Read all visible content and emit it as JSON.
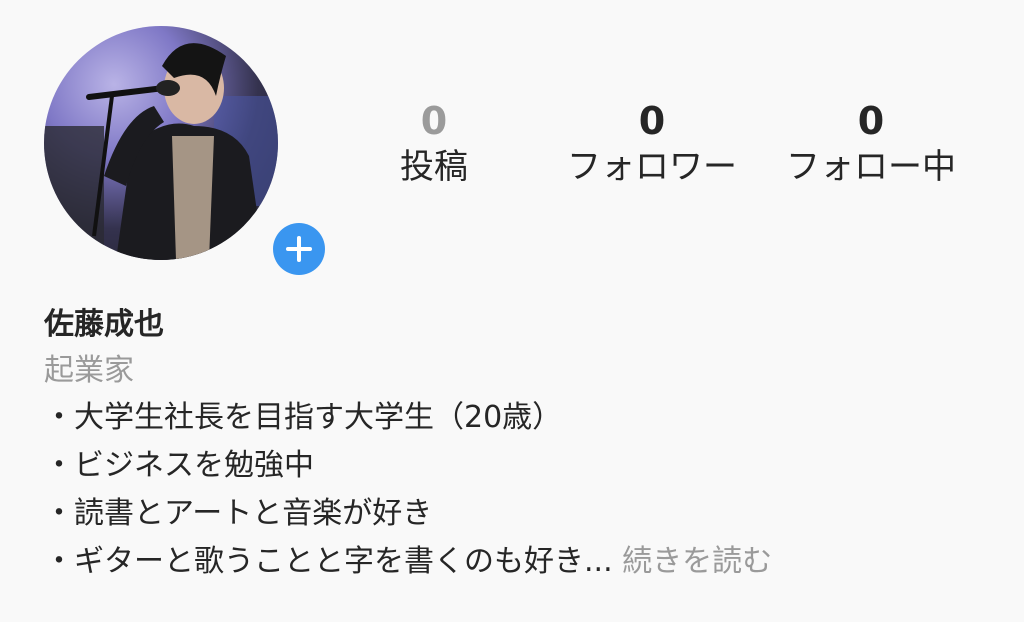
{
  "profile": {
    "name": "佐藤成也",
    "category": "起業家"
  },
  "stats": {
    "posts": {
      "count": "0",
      "label": "投稿"
    },
    "followers": {
      "count": "0",
      "label": "フォロワー"
    },
    "following": {
      "count": "0",
      "label": "フォロー中"
    }
  },
  "bio": {
    "lines": [
      "・大学生社長を目指す大学生（20歳）",
      "・ビジネスを勉強中",
      "・読書とアートと音楽が好き"
    ],
    "last_line": "・ギターと歌うことと字を書くのも好き...",
    "more_label": "続きを読む"
  },
  "colors": {
    "accent": "#3a96f0",
    "muted": "#9a9a9a",
    "background": "#f9f9f9"
  },
  "icons": {
    "add_story": "plus-icon"
  }
}
